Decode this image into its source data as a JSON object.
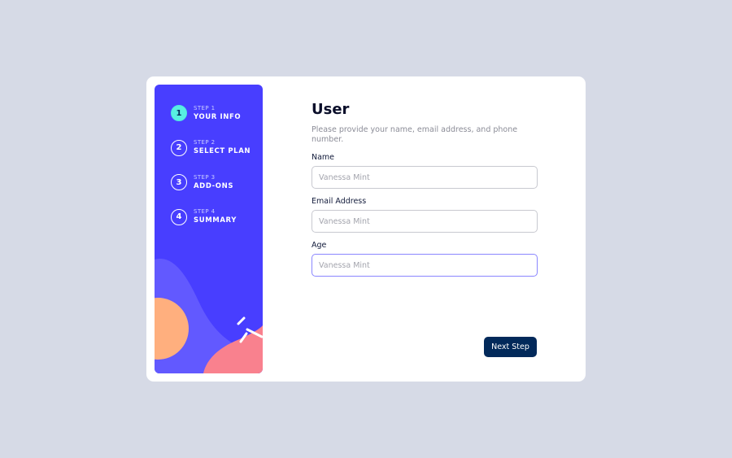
{
  "sidebar": {
    "steps": [
      {
        "number": "1",
        "caption": "STEP 1",
        "title": "YOUR INFO",
        "active": true
      },
      {
        "number": "2",
        "caption": "STEP 2",
        "title": "SELECT PLAN",
        "active": false
      },
      {
        "number": "3",
        "caption": "STEP 3",
        "title": "ADD-ONS",
        "active": false
      },
      {
        "number": "4",
        "caption": "STEP 4",
        "title": "SUMMARY",
        "active": false
      }
    ]
  },
  "main": {
    "title": "User",
    "subtitle": "Please provide your name, email address, and phone number.",
    "fields": [
      {
        "label": "Name",
        "value": "",
        "placeholder": "Vanessa Mint"
      },
      {
        "label": "Email Address",
        "value": "",
        "placeholder": "Vanessa Mint"
      },
      {
        "label": "Age",
        "value": "",
        "placeholder": "Vanessa Mint",
        "focused": true
      }
    ],
    "next_label": "Next Step"
  },
  "colors": {
    "background": "#d6dae6",
    "sidebar": "#483eff",
    "active_step": "#58eee2",
    "button": "#02295a",
    "focus_border": "#8a86ff"
  }
}
